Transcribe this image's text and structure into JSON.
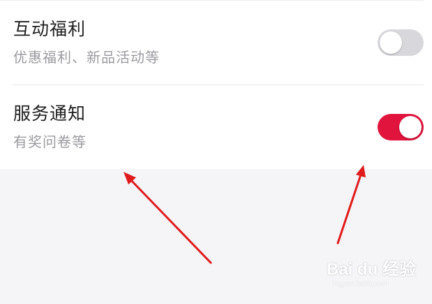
{
  "settings": [
    {
      "title": "互动福利",
      "subtitle": "优惠福利、新品活动等",
      "enabled": false
    },
    {
      "title": "服务通知",
      "subtitle": "有奖问卷等",
      "enabled": true
    }
  ],
  "colors": {
    "toggle_on": "#e0143d",
    "toggle_off": "#d8d8dc",
    "annotation_arrow": "#e01b1b",
    "page_background": "#f5f4f7",
    "panel_background": "#ffffff"
  },
  "watermark": {
    "logo": "Bai du 经验",
    "url": "jingyan.baidu.com"
  }
}
